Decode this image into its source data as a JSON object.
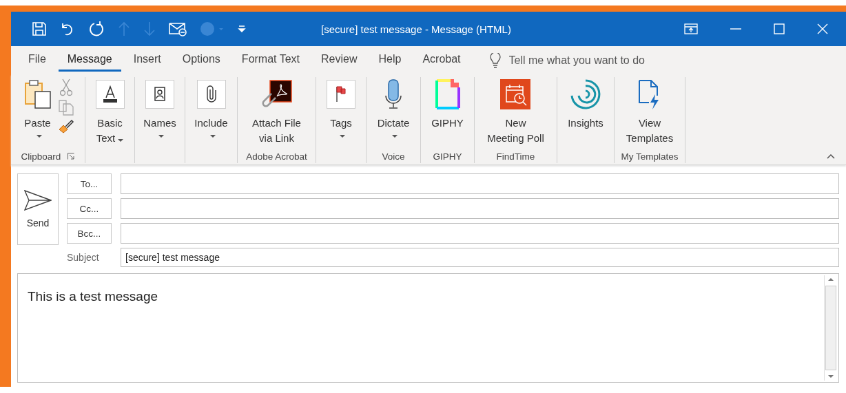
{
  "window": {
    "title": "[secure] test message  -  Message (HTML)"
  },
  "tabs": [
    {
      "label": "File",
      "selected": false
    },
    {
      "label": "Message",
      "selected": true
    },
    {
      "label": "Insert",
      "selected": false
    },
    {
      "label": "Options",
      "selected": false
    },
    {
      "label": "Format Text",
      "selected": false
    },
    {
      "label": "Review",
      "selected": false
    },
    {
      "label": "Help",
      "selected": false
    },
    {
      "label": "Acrobat",
      "selected": false
    }
  ],
  "search": {
    "placeholder": "Tell me what you want to do"
  },
  "ribbon_groups": [
    {
      "label": "Clipboard",
      "launcher": true,
      "buttons": [
        {
          "label": "Paste",
          "kind": "dropdown"
        }
      ]
    },
    {
      "buttons": [
        {
          "label": "Basic\nText",
          "kind": "inline"
        }
      ]
    },
    {
      "buttons": [
        {
          "label": "Names",
          "kind": "dropdown"
        }
      ]
    },
    {
      "buttons": [
        {
          "label": "Include",
          "kind": "dropdown"
        }
      ]
    },
    {
      "label": "Adobe Acrobat",
      "buttons": [
        {
          "label": "Attach File\nvia Link",
          "kind": "plain"
        }
      ]
    },
    {
      "buttons": [
        {
          "label": "Tags",
          "kind": "dropdown"
        }
      ]
    },
    {
      "label": "Voice",
      "buttons": [
        {
          "label": "Dictate",
          "kind": "dropdown"
        }
      ]
    },
    {
      "label": "GIPHY",
      "buttons": [
        {
          "label": "GIPHY",
          "kind": "plain"
        }
      ]
    },
    {
      "label": "FindTime",
      "buttons": [
        {
          "label": "New\nMeeting Poll",
          "kind": "plain"
        }
      ]
    },
    {
      "buttons": [
        {
          "label": "Insights",
          "kind": "plain"
        }
      ]
    },
    {
      "label": "My Templates",
      "buttons": [
        {
          "label": "View\nTemplates",
          "kind": "plain"
        }
      ]
    }
  ],
  "compose": {
    "send": "Send",
    "recipients": [
      {
        "button": "To..."
      },
      {
        "button": "Cc..."
      },
      {
        "button": "Bcc..."
      }
    ],
    "subject_label": "Subject",
    "subject": "[secure] test message",
    "body": "This is a test message"
  }
}
